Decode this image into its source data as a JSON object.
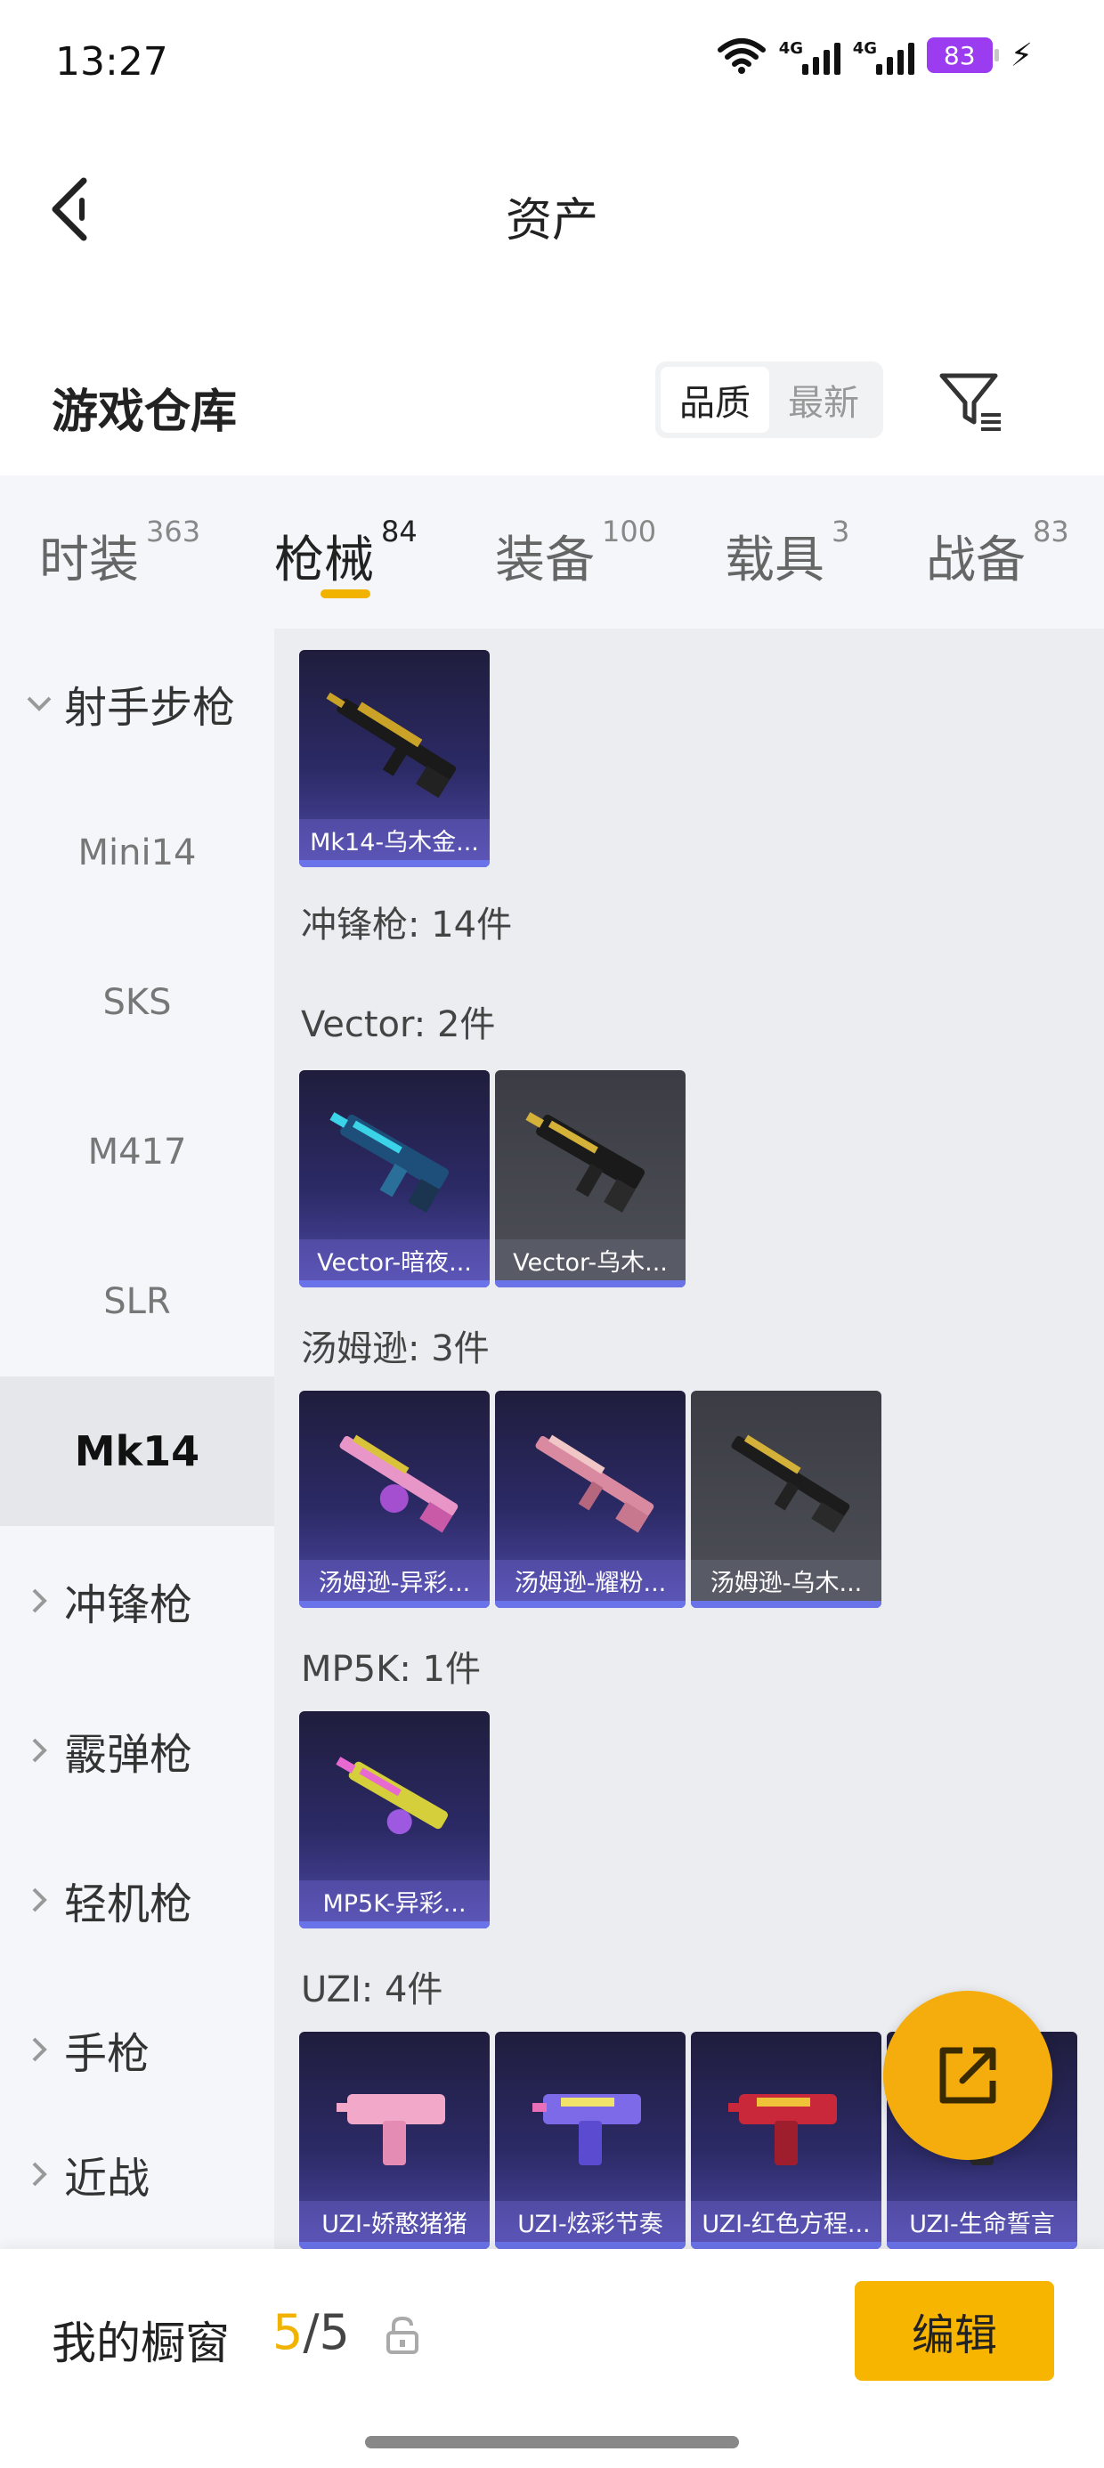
{
  "status_bar": {
    "time": "13:27",
    "battery": "83",
    "signal1_label": "4G",
    "signal2_label": "4G"
  },
  "header": {
    "title": "资产"
  },
  "section": {
    "title": "游戏仓库",
    "sort_options": [
      "品质",
      "最新"
    ],
    "sort_active": "品质"
  },
  "tabs": [
    {
      "label": "时装",
      "count": "363"
    },
    {
      "label": "枪械",
      "count": "84",
      "active": true
    },
    {
      "label": "装备",
      "count": "100"
    },
    {
      "label": "载具",
      "count": "3"
    },
    {
      "label": "战备",
      "count": "83"
    }
  ],
  "sidebar": {
    "items": [
      {
        "label": "射手步枪",
        "expanded": true
      },
      {
        "label": "Mini14"
      },
      {
        "label": "SKS"
      },
      {
        "label": "M417"
      },
      {
        "label": "SLR"
      },
      {
        "label": "Mk14",
        "selected": true
      },
      {
        "label": "冲锋枪"
      },
      {
        "label": "霰弹枪"
      },
      {
        "label": "轻机枪"
      },
      {
        "label": "手枪"
      },
      {
        "label": "近战"
      }
    ]
  },
  "content": {
    "mk14_cards": [
      {
        "name": "Mk14-乌木金...",
        "tier": "purple"
      }
    ],
    "smg_label": "冲锋枪: 14件",
    "vector": {
      "label": "Vector: 2件",
      "cards": [
        {
          "name": "Vector-暗夜...",
          "tier": "purple"
        },
        {
          "name": "Vector-乌木...",
          "tier": "grey"
        }
      ]
    },
    "thompson": {
      "label": "汤姆逊: 3件",
      "cards": [
        {
          "name": "汤姆逊-异彩...",
          "tier": "purple"
        },
        {
          "name": "汤姆逊-耀粉...",
          "tier": "purple"
        },
        {
          "name": "汤姆逊-乌木...",
          "tier": "grey"
        }
      ]
    },
    "mp5k": {
      "label": "MP5K: 1件",
      "cards": [
        {
          "name": "MP5K-异彩...",
          "tier": "purple"
        }
      ]
    },
    "uzi": {
      "label": "UZI: 4件",
      "cards": [
        {
          "name": "UZI-娇憨猪猪",
          "tier": "purple"
        },
        {
          "name": "UZI-炫彩节奏",
          "tier": "purple"
        },
        {
          "name": "UZI-红色方程...",
          "tier": "purple"
        },
        {
          "name": "UZI-生命誓言",
          "tier": "purple"
        }
      ]
    }
  },
  "bottom_bar": {
    "label": "我的橱窗",
    "count_current": "5",
    "count_sep_total": "/5",
    "edit_label": "编辑"
  },
  "colors": {
    "accent": "#f7b500",
    "selected_bg": "#e5e7eb",
    "card_purple": "#2c2a66",
    "card_grey": "#4e5058"
  }
}
